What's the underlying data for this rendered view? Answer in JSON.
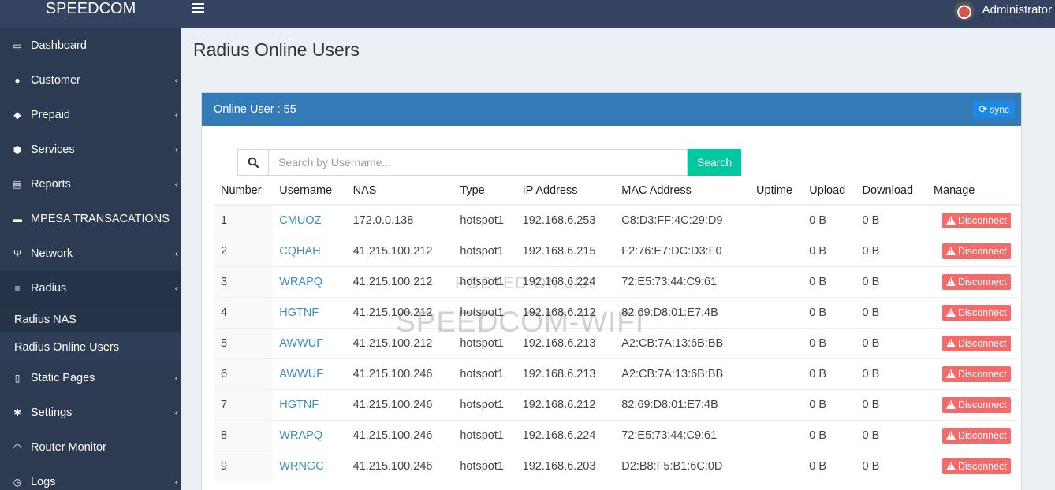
{
  "brand": "SPEEDCOM",
  "user": {
    "name": "Administrator"
  },
  "sidebar": {
    "items": [
      {
        "label": "Dashboard",
        "icon": "monitor-icon",
        "glyph": "▭",
        "chevron": false
      },
      {
        "label": "Customer",
        "icon": "users-icon",
        "glyph": "●",
        "chevron": true
      },
      {
        "label": "Prepaid",
        "icon": "ticket-icon",
        "glyph": "◆",
        "chevron": true
      },
      {
        "label": "Services",
        "icon": "cube-icon",
        "glyph": "⬢",
        "chevron": true
      },
      {
        "label": "Reports",
        "icon": "document-icon",
        "glyph": "▤",
        "chevron": true
      },
      {
        "label": "MPESA TRANSACATIONS",
        "icon": "money-icon",
        "glyph": "▬",
        "chevron": false
      },
      {
        "label": "Network",
        "icon": "network-icon",
        "glyph": "Ψ",
        "chevron": true
      },
      {
        "label": "Radius",
        "icon": "database-icon",
        "glyph": "≡",
        "chevron": true
      },
      {
        "label": "Static Pages",
        "icon": "file-icon",
        "glyph": "▯",
        "chevron": true
      },
      {
        "label": "Settings",
        "icon": "gear-icon",
        "glyph": "✱",
        "chevron": true
      },
      {
        "label": "Router Monitor",
        "icon": "wifi-icon",
        "glyph": "◠",
        "chevron": false
      },
      {
        "label": "Logs",
        "icon": "clock-icon",
        "glyph": "◷",
        "chevron": true
      }
    ],
    "radius_submenu": [
      {
        "label": "Radius NAS"
      },
      {
        "label": "Radius Online Users"
      }
    ]
  },
  "page": {
    "title": "Radius Online Users"
  },
  "panel": {
    "header": "Online User : 55",
    "sync_label": "sync"
  },
  "search": {
    "placeholder": "Search by Username...",
    "button_label": "Search"
  },
  "table": {
    "columns": [
      "Number",
      "Username",
      "NAS",
      "Type",
      "IP Address",
      "MAC Address",
      "Uptime",
      "Upload",
      "Download",
      "Manage"
    ],
    "rows": [
      {
        "number": "1",
        "username": "CMUOZ",
        "nas": "172.0.0.138",
        "type": "hotspot1",
        "ip": "192.168.6.253",
        "mac": "C8:D3:FF:4C:29:D9",
        "uptime": "",
        "upload": "0 B",
        "download": "0 B"
      },
      {
        "number": "2",
        "username": "CQHAH",
        "nas": "41.215.100.212",
        "type": "hotspot1",
        "ip": "192.168.6.215",
        "mac": "F2:76:E7:DC:D3:F0",
        "uptime": "",
        "upload": "0 B",
        "download": "0 B"
      },
      {
        "number": "3",
        "username": "WRAPQ",
        "nas": "41.215.100.212",
        "type": "hotspot1",
        "ip": "192.168.6.224",
        "mac": "72:E5:73:44:C9:61",
        "uptime": "",
        "upload": "0 B",
        "download": "0 B"
      },
      {
        "number": "4",
        "username": "HGTNF",
        "nas": "41.215.100.212",
        "type": "hotspot1",
        "ip": "192.168.6.212",
        "mac": "82:69:D8:01:E7:4B",
        "uptime": "",
        "upload": "0 B",
        "download": "0 B"
      },
      {
        "number": "5",
        "username": "AWWUF",
        "nas": "41.215.100.212",
        "type": "hotspot1",
        "ip": "192.168.6.213",
        "mac": "A2:CB:7A:13:6B:BB",
        "uptime": "",
        "upload": "0 B",
        "download": "0 B"
      },
      {
        "number": "6",
        "username": "AWWUF",
        "nas": "41.215.100.246",
        "type": "hotspot1",
        "ip": "192.168.6.213",
        "mac": "A2:CB:7A:13:6B:BB",
        "uptime": "",
        "upload": "0 B",
        "download": "0 B"
      },
      {
        "number": "7",
        "username": "HGTNF",
        "nas": "41.215.100.246",
        "type": "hotspot1",
        "ip": "192.168.6.212",
        "mac": "82:69:D8:01:E7:4B",
        "uptime": "",
        "upload": "0 B",
        "download": "0 B"
      },
      {
        "number": "8",
        "username": "WRAPQ",
        "nas": "41.215.100.246",
        "type": "hotspot1",
        "ip": "192.168.6.224",
        "mac": "72:E5:73:44:C9:61",
        "uptime": "",
        "upload": "0 B",
        "download": "0 B"
      },
      {
        "number": "9",
        "username": "WRNGC",
        "nas": "41.215.100.246",
        "type": "hotspot1",
        "ip": "192.168.6.203",
        "mac": "D2:B8:F5:B1:6C:0D",
        "uptime": "",
        "upload": "0 B",
        "download": "0 B"
      }
    ],
    "action_label": "Disconnect"
  },
  "watermark": {
    "line1": "POSTED ON JIJI",
    "line2": "SPEEDCOM-WIFI"
  },
  "colors": {
    "topbar": "#344460",
    "sidebar": "#2c3b51",
    "panel_header": "#337ab7",
    "search_button": "#00c8a0",
    "disconnect": "#f16b6b",
    "link": "#3c8dbc"
  }
}
